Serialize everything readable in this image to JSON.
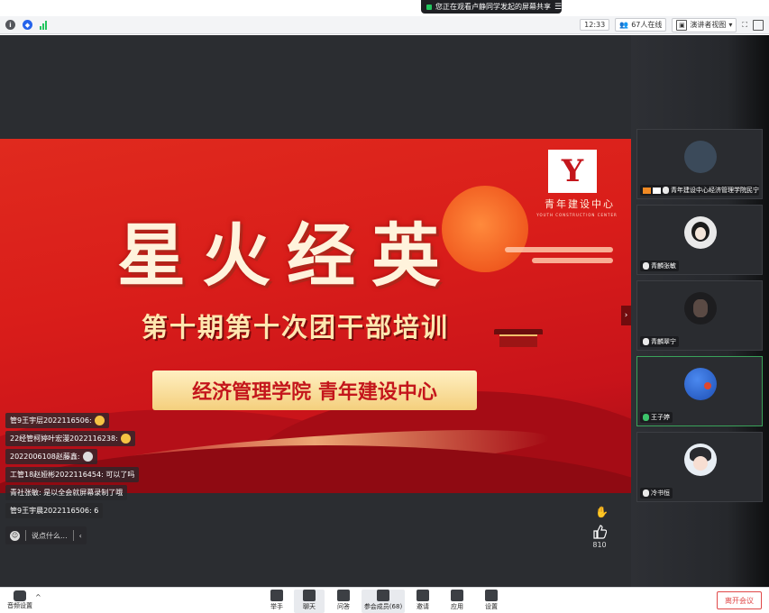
{
  "share_banner": {
    "text": "您正在观看卢静同学发起的屏幕共享",
    "menu": "☰"
  },
  "status_bar": {
    "time": "12:33",
    "participants": "67人在线",
    "view_mode": "演讲者视图",
    "view_caret": "▾",
    "fullscreen": "⛶"
  },
  "slide": {
    "title": "星火经英",
    "subtitle": "第十期第十次团干部培训",
    "banner": "经济管理学院 青年建设中心",
    "logo_mark": "Y",
    "logo_text": "青年建设中心",
    "logo_subtext": "YOUTH CONSTRUCTION CENTER"
  },
  "chat": {
    "messages": [
      "管9王宇层2022116506:",
      "22经管柯婷叶宏漫2022116238:",
      "2022006108赵藤鑫:",
      "工管18赵娅彬2022116454: 可以了吗",
      "青社张敏: 是以全会就屏幕录制了哦",
      "管9王宇晨2022116506: 6"
    ],
    "input_placeholder": "说点什么...",
    "collapse_label": "‹"
  },
  "reactions": {
    "like_count": "810"
  },
  "participants": [
    {
      "name": "青年建设中心经济管理学院民宁",
      "avatar_color": "#3b4a5a"
    },
    {
      "name": "青麟张敏",
      "avatar_color": "#e9e9e9"
    },
    {
      "name": "青麟翠宁",
      "avatar_color": "#1d1d1f"
    },
    {
      "name": "王子婷",
      "avatar_color": "#2b6bd6"
    },
    {
      "name": "冷书恒",
      "avatar_color": "#e8eef4"
    }
  ],
  "toolbar": {
    "audio_label": "音频设置",
    "audio_caret": "^",
    "buttons": [
      {
        "label": "举手"
      },
      {
        "label": "聊天"
      },
      {
        "label": "问答"
      },
      {
        "label": "参会成员(68)"
      },
      {
        "label": "邀请"
      },
      {
        "label": "应用"
      },
      {
        "label": "设置"
      }
    ],
    "leave_label": "离开会议"
  },
  "colors": {
    "accent": "#2563eb",
    "leave": "#e04848",
    "slide_red": "#d91d1a"
  }
}
